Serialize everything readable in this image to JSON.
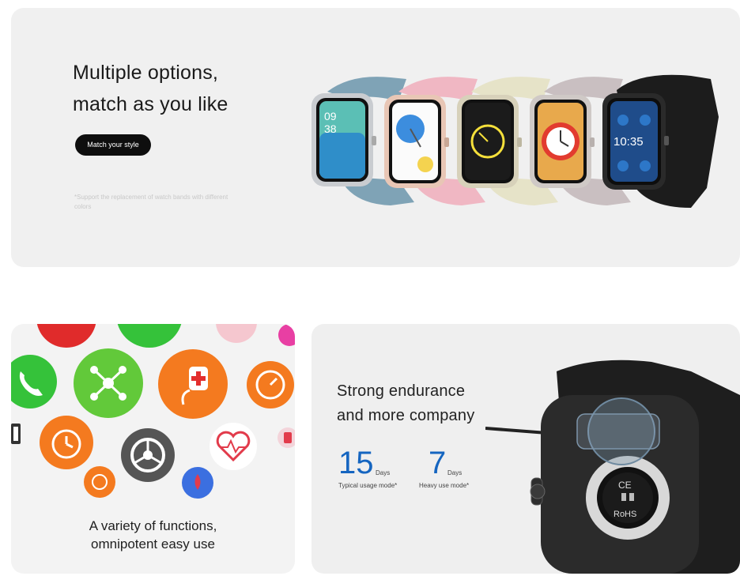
{
  "top": {
    "headline_line1": "Multiple options,",
    "headline_line2": "match as you like",
    "button_label": "Match your style",
    "footnote": "*Support the replacement of watch bands with different colors"
  },
  "bottom_left": {
    "caption_line1": "A variety of functions,",
    "caption_line2": "omnipotent easy use",
    "icons": [
      "heart-icon",
      "phone-icon",
      "network-icon",
      "health-icon",
      "timer-icon",
      "alarm-icon",
      "settings-icon",
      "heart-rate-icon",
      "cardio-icon",
      "blood-oxygen-icon",
      "battery-icon",
      "bp-icon"
    ]
  },
  "bottom_right": {
    "headline_line1": "Strong endurance",
    "headline_line2": "and more company",
    "stat1_value": "15",
    "stat1_unit": "Days",
    "stat1_label": "Typical usage mode*",
    "stat2_value": "7",
    "stat2_unit": "Days",
    "stat2_label": "Heavy use mode*",
    "watch_back_text1": "CE",
    "watch_back_text2": "RoHS"
  },
  "colors": {
    "accent_blue": "#1565c0",
    "band_blue": "#7fa3b6",
    "band_pink": "#f0b7c3",
    "band_cream": "#e6e3c8",
    "band_mauve": "#c9bfc1",
    "band_black": "#1c1c1c"
  }
}
